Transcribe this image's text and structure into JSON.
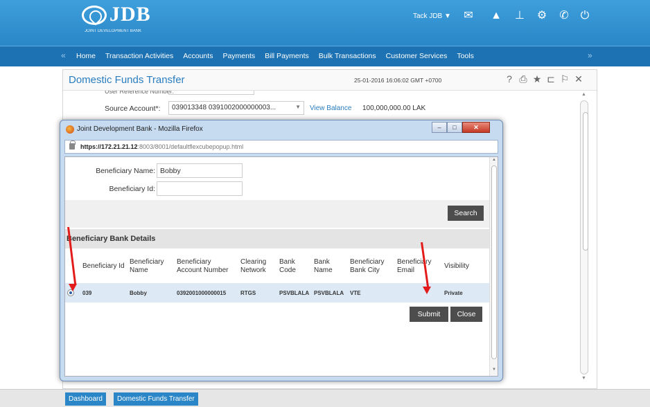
{
  "header": {
    "logo_text": "JDB",
    "logo_subtitle": "JOINT DEVELOPMENT BANK",
    "user_menu_label": "Tack JDB",
    "icons": [
      "mail-icon",
      "alert-icon",
      "sitemap-icon",
      "gear-icon",
      "phone-icon",
      "power-icon"
    ]
  },
  "nav": {
    "items": [
      {
        "label": "Home"
      },
      {
        "label": "Transaction Activities"
      },
      {
        "label": "Accounts"
      },
      {
        "label": "Payments"
      },
      {
        "label": "Bill Payments"
      },
      {
        "label": "Bulk Transactions"
      },
      {
        "label": "Customer Services"
      },
      {
        "label": "Tools"
      }
    ]
  },
  "page": {
    "title": "Domestic Funds Transfer",
    "timestamp": "25-01-2016 16:06:02 GMT +0700",
    "cut_label": "User Reference Number:",
    "source_account_label": "Source Account*:",
    "source_account_value": "039013348 0391002000000003...",
    "view_balance_label": "View Balance",
    "balance_value": "100,000,000.00 LAK"
  },
  "popup": {
    "title": "Joint Development Bank - Mozilla Firefox",
    "url_host": "https://172.21.21.12",
    "url_rest": ":8003/8001/defaultflexcubepopup.html",
    "beneficiary_name_label": "Beneficiary Name:",
    "beneficiary_name_value": "Bobby",
    "beneficiary_id_label": "Beneficiary Id:",
    "beneficiary_id_value": "",
    "search_label": "Search",
    "section_title": "Beneficiary Bank Details",
    "columns": [
      "Beneficiary Id",
      "Beneficiary Name",
      "Beneficiary Account Number",
      "Clearing Network",
      "Bank Code",
      "Bank Name",
      "Beneficiary Bank City",
      "Beneficiary Email",
      "Visibility"
    ],
    "rows": [
      {
        "id": "039",
        "name": "Bobby",
        "account": "0392001000000015",
        "network": "RTGS",
        "bank_code": "PSVBLALA",
        "bank_name": "PSVBLALA",
        "city": "VTE",
        "email": "",
        "visibility": "Private"
      }
    ],
    "submit_label": "Submit",
    "close_label": "Close"
  },
  "footer": {
    "tabs": [
      {
        "label": "Dashboard"
      },
      {
        "label": "Domestic Funds Transfer"
      }
    ]
  },
  "colors": {
    "brand_blue": "#2a86c7",
    "nav_blue": "#1c72b3",
    "title_blue": "#2a7dbf",
    "dark_button": "#4d4d4d",
    "annotation_red": "#e31b1b"
  }
}
